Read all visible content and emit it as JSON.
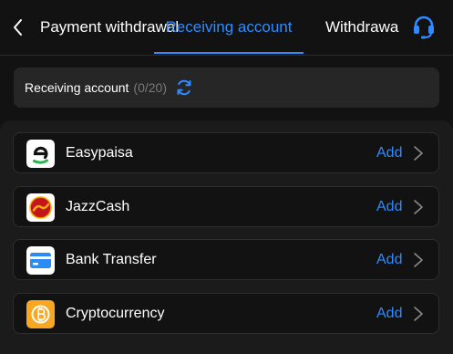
{
  "header": {
    "tabs": [
      {
        "label": "Payment withdrawal",
        "active": false
      },
      {
        "label": "Receiving account",
        "active": true
      },
      {
        "label": "Withdrawal history",
        "active": false
      }
    ],
    "back_icon": "chevron-left-icon",
    "support_icon": "headset-icon",
    "active_color": "#2f8bff"
  },
  "summary": {
    "title": "Receiving account",
    "count": "(0/20)",
    "refresh_icon": "refresh-icon"
  },
  "methods": [
    {
      "name": "Easypaisa",
      "action": "Add",
      "icon": "easypaisa-logo-icon"
    },
    {
      "name": "JazzCash",
      "action": "Add",
      "icon": "jazzcash-logo-icon"
    },
    {
      "name": "Bank Transfer",
      "action": "Add",
      "icon": "bank-card-icon"
    },
    {
      "name": "Cryptocurrency",
      "action": "Add",
      "icon": "bitcoin-icon"
    }
  ],
  "colors": {
    "background": "#121212",
    "panel": "#1b1b1b",
    "accent": "#2f8bff",
    "muted": "#7a7a7a"
  }
}
